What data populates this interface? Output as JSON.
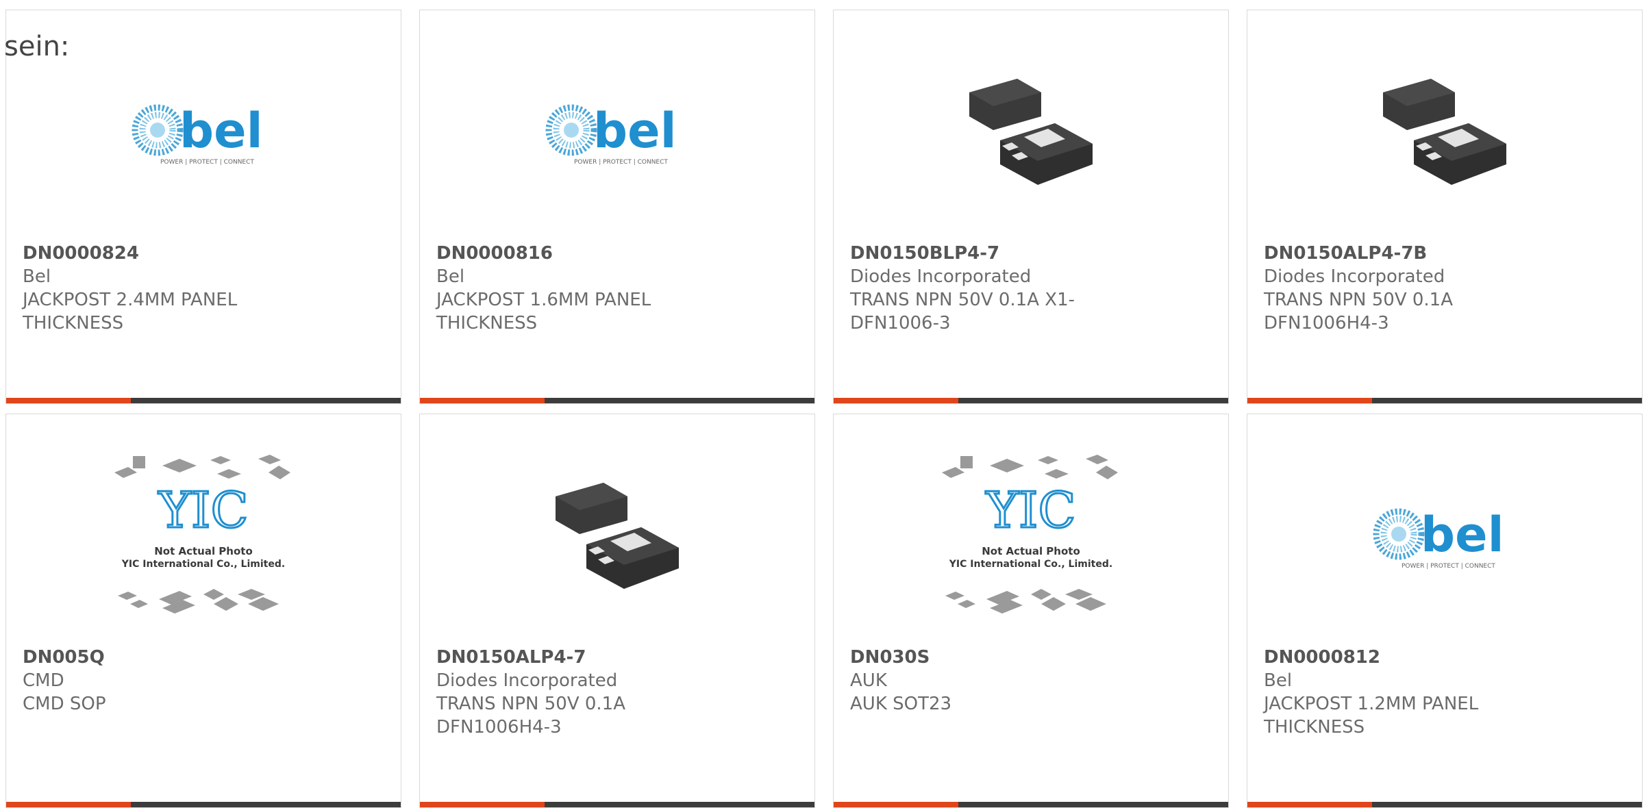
{
  "lead_text": "sein:",
  "cards": [
    {
      "part": "DN0000824",
      "manufacturer": "Bel",
      "description": "JACKPOST 2.4MM PANEL THICKNESS",
      "image": "bel-logo",
      "logo_tagline": "POWER | PROTECT | CONNECT",
      "logo_text": "bel"
    },
    {
      "part": "DN0000816",
      "manufacturer": "Bel",
      "description": "JACKPOST 1.6MM PANEL THICKNESS",
      "image": "bel-logo",
      "logo_tagline": "POWER | PROTECT | CONNECT",
      "logo_text": "bel"
    },
    {
      "part": "DN0150BLP4-7",
      "manufacturer": "Diodes Incorporated",
      "description": "TRANS NPN 50V 0.1A X1-DFN1006-3",
      "image": "dfn-package"
    },
    {
      "part": "DN0150ALP4-7B",
      "manufacturer": "Diodes Incorporated",
      "description": "TRANS NPN 50V 0.1A DFN1006H4-3",
      "image": "dfn-package"
    },
    {
      "part": "DN005Q",
      "manufacturer": "CMD",
      "description": "CMD SOP",
      "image": "yic-placeholder",
      "placeholder_line1": "Not Actual Photo",
      "placeholder_line2": "YIC International Co., Limited."
    },
    {
      "part": "DN0150ALP4-7",
      "manufacturer": "Diodes Incorporated",
      "description": "TRANS NPN 50V 0.1A DFN1006H4-3",
      "image": "dfn-package"
    },
    {
      "part": "DN030S",
      "manufacturer": "AUK",
      "description": "AUK SOT23",
      "image": "yic-placeholder",
      "placeholder_line1": "Not Actual Photo",
      "placeholder_line2": "YIC International Co., Limited."
    },
    {
      "part": "DN0000812",
      "manufacturer": "Bel",
      "description": "JACKPOST 1.2MM PANEL THICKNESS",
      "image": "bel-logo",
      "logo_tagline": "POWER | PROTECT | CONNECT",
      "logo_text": "bel"
    }
  ],
  "colors": {
    "accent": "#e0461b",
    "bar": "#3c3c3c",
    "bel_blue": "#1f8fd0",
    "text": "#6b6b6b"
  }
}
